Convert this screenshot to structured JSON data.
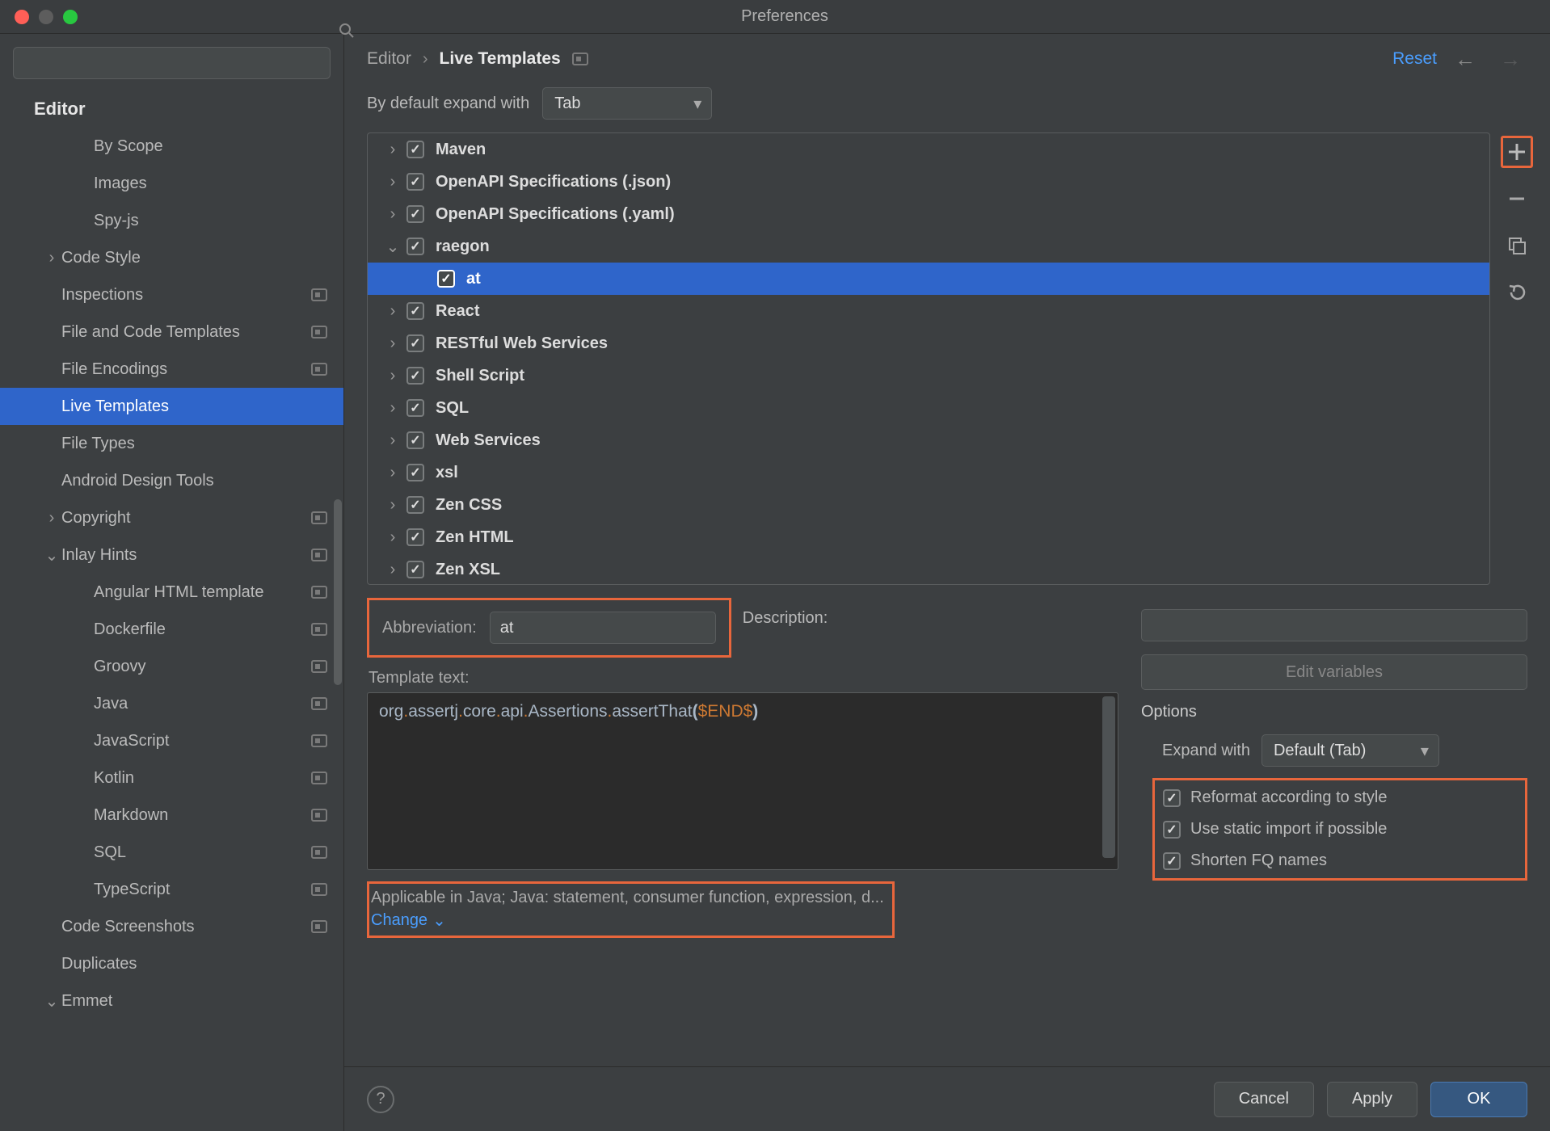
{
  "window": {
    "title": "Preferences"
  },
  "search": {
    "placeholder": ""
  },
  "sidebar": {
    "category": "Editor",
    "items": [
      {
        "label": "By Scope",
        "depth": 2,
        "expand": "",
        "proj": false
      },
      {
        "label": "Images",
        "depth": 2,
        "expand": "",
        "proj": false
      },
      {
        "label": "Spy-js",
        "depth": 2,
        "expand": "",
        "proj": false
      },
      {
        "label": "Code Style",
        "depth": 1,
        "expand": "right",
        "proj": false
      },
      {
        "label": "Inspections",
        "depth": 1,
        "expand": "",
        "proj": true
      },
      {
        "label": "File and Code Templates",
        "depth": 1,
        "expand": "",
        "proj": true
      },
      {
        "label": "File Encodings",
        "depth": 1,
        "expand": "",
        "proj": true
      },
      {
        "label": "Live Templates",
        "depth": 1,
        "expand": "",
        "proj": false,
        "selected": true
      },
      {
        "label": "File Types",
        "depth": 1,
        "expand": "",
        "proj": false
      },
      {
        "label": "Android Design Tools",
        "depth": 1,
        "expand": "",
        "proj": false
      },
      {
        "label": "Copyright",
        "depth": 1,
        "expand": "right",
        "proj": true
      },
      {
        "label": "Inlay Hints",
        "depth": 1,
        "expand": "down",
        "proj": true
      },
      {
        "label": "Angular HTML template",
        "depth": 2,
        "expand": "",
        "proj": true
      },
      {
        "label": "Dockerfile",
        "depth": 2,
        "expand": "",
        "proj": true
      },
      {
        "label": "Groovy",
        "depth": 2,
        "expand": "",
        "proj": true
      },
      {
        "label": "Java",
        "depth": 2,
        "expand": "",
        "proj": true
      },
      {
        "label": "JavaScript",
        "depth": 2,
        "expand": "",
        "proj": true
      },
      {
        "label": "Kotlin",
        "depth": 2,
        "expand": "",
        "proj": true
      },
      {
        "label": "Markdown",
        "depth": 2,
        "expand": "",
        "proj": true
      },
      {
        "label": "SQL",
        "depth": 2,
        "expand": "",
        "proj": true
      },
      {
        "label": "TypeScript",
        "depth": 2,
        "expand": "",
        "proj": true
      },
      {
        "label": "Code Screenshots",
        "depth": 1,
        "expand": "",
        "proj": true
      },
      {
        "label": "Duplicates",
        "depth": 1,
        "expand": "",
        "proj": false
      },
      {
        "label": "Emmet",
        "depth": 1,
        "expand": "down",
        "proj": false
      }
    ]
  },
  "breadcrumb": {
    "section": "Editor",
    "page": "Live Templates",
    "reset": "Reset"
  },
  "expand": {
    "label": "By default expand with",
    "value": "Tab"
  },
  "templates": [
    {
      "name": "Maven",
      "expand": "right",
      "checked": true
    },
    {
      "name": "OpenAPI Specifications (.json)",
      "expand": "right",
      "checked": true
    },
    {
      "name": "OpenAPI Specifications (.yaml)",
      "expand": "right",
      "checked": true
    },
    {
      "name": "raegon",
      "expand": "down",
      "checked": true
    },
    {
      "name": "at",
      "expand": "",
      "checked": true,
      "child": true,
      "selected": true
    },
    {
      "name": "React",
      "expand": "right",
      "checked": true
    },
    {
      "name": "RESTful Web Services",
      "expand": "right",
      "checked": true
    },
    {
      "name": "Shell Script",
      "expand": "right",
      "checked": true
    },
    {
      "name": "SQL",
      "expand": "right",
      "checked": true
    },
    {
      "name": "Web Services",
      "expand": "right",
      "checked": true
    },
    {
      "name": "xsl",
      "expand": "right",
      "checked": true
    },
    {
      "name": "Zen CSS",
      "expand": "right",
      "checked": true
    },
    {
      "name": "Zen HTML",
      "expand": "right",
      "checked": true
    },
    {
      "name": "Zen XSL",
      "expand": "right",
      "checked": true
    }
  ],
  "form": {
    "abbr_label": "Abbreviation:",
    "abbr_value": "at",
    "desc_label": "Description:",
    "desc_value": "",
    "template_text_label": "Template text:",
    "template_code": "org.assertj.core.api.Assertions.assertThat($END$)",
    "applicable_text": "Applicable in Java; Java: statement, consumer function, expression, d...",
    "change": "Change",
    "edit_vars": "Edit variables"
  },
  "options": {
    "title": "Options",
    "expand_label": "Expand with",
    "expand_value": "Default (Tab)",
    "reformat": "Reformat according to style",
    "static_import": "Use static import if possible",
    "shorten": "Shorten FQ names"
  },
  "footer": {
    "cancel": "Cancel",
    "apply": "Apply",
    "ok": "OK"
  }
}
